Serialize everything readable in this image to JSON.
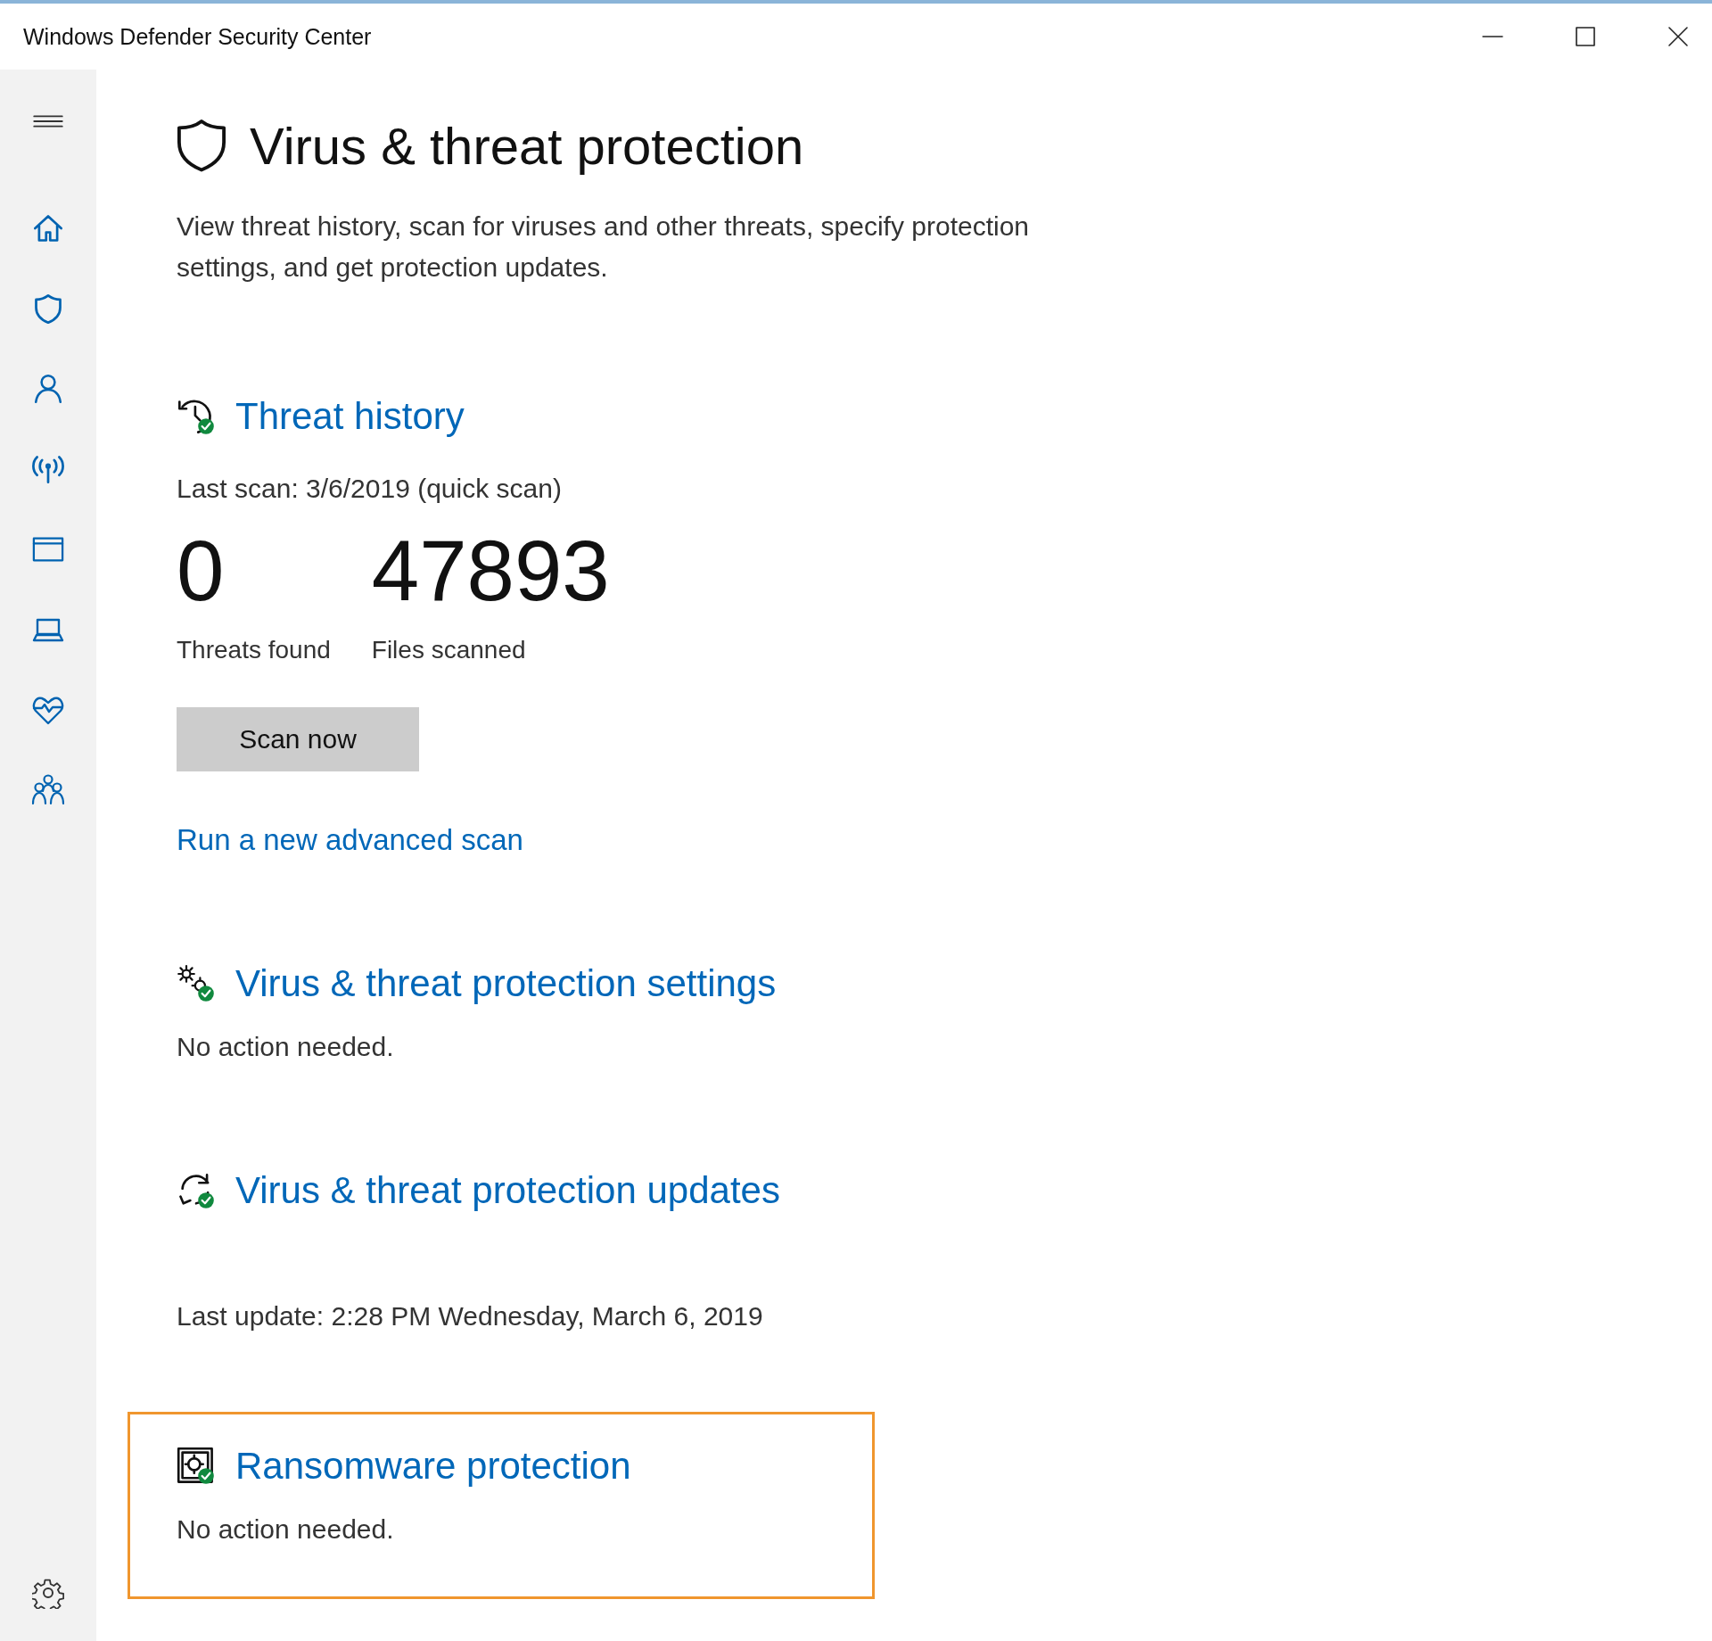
{
  "window": {
    "title": "Windows Defender Security Center"
  },
  "page": {
    "title": "Virus & threat protection",
    "description": "View threat history, scan for viruses and other threats, specify protection settings, and get protection updates."
  },
  "sections": [
    {
      "kind": "history",
      "title": "Threat history",
      "focused": false,
      "status": "Last scan: 3/6/2019 (quick scan)",
      "stats": [
        {
          "value": "0",
          "label": "Threats found"
        },
        {
          "value": "47893",
          "label": "Files scanned"
        }
      ],
      "button": "Scan now",
      "link": "Run a new advanced scan"
    },
    {
      "kind": "settings",
      "title": "Virus & threat protection settings",
      "focused": false,
      "status": "No action needed."
    },
    {
      "kind": "updates",
      "title": "Virus & threat protection updates",
      "focused": false,
      "status": "Last update: 2:28 PM Wednesday, March 6, 2019"
    },
    {
      "kind": "ransomware",
      "title": "Ransomware protection",
      "focused": true,
      "status": "No action needed."
    }
  ]
}
